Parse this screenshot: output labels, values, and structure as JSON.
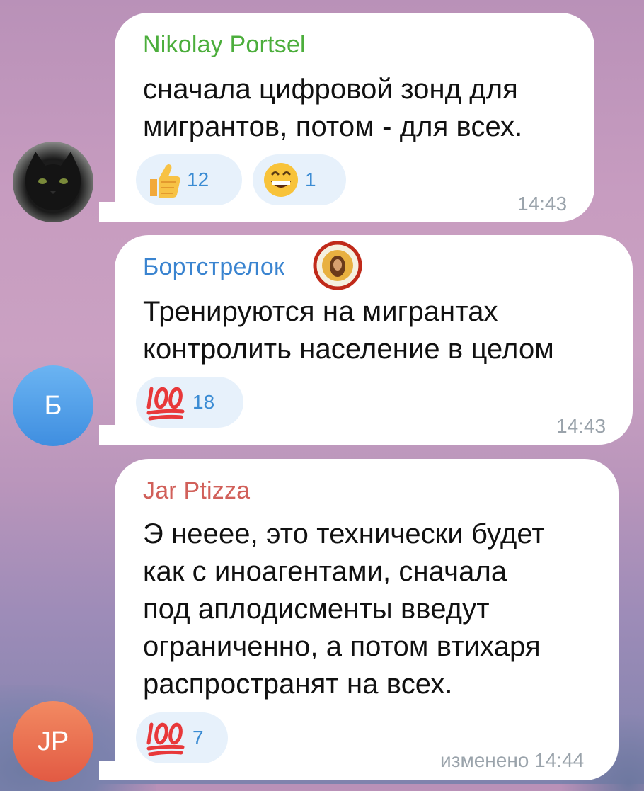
{
  "messages": [
    {
      "sender": "Nikolay Portsel",
      "sender_color": "#4cae3c",
      "text": "сначала цифровой зонд для\nмигрантов, потом - для всех.",
      "reactions": [
        {
          "emoji": "thumbs-up",
          "count": "12"
        },
        {
          "emoji": "grinning-face",
          "count": "1"
        }
      ],
      "time": "14:43",
      "avatar": {
        "type": "photo",
        "icon": "black-cat-avatar"
      }
    },
    {
      "sender": "Бортстрелок",
      "sender_color": "#3a84d0",
      "text": "Тренируются на мигрантах\nконтролить население в целом",
      "reactions": [
        {
          "emoji": "hundred-points",
          "count": "18"
        }
      ],
      "time": "14:43",
      "avatar": {
        "type": "initials",
        "initials": "Б",
        "color": "#4f9ee8"
      }
    },
    {
      "sender": "Jar Ptizza",
      "sender_color": "#d1605a",
      "text": "Э нееее, это технически будет\nкак с иноагентами, сначала\nпод аплодисменты введут\nограниченно, а потом втихаря\nраспространят на всех.",
      "reactions": [
        {
          "emoji": "hundred-points",
          "count": "7"
        }
      ],
      "time": "изменено 14:44",
      "avatar": {
        "type": "initials",
        "initials": "JP",
        "color": "#e8694e"
      }
    }
  ]
}
